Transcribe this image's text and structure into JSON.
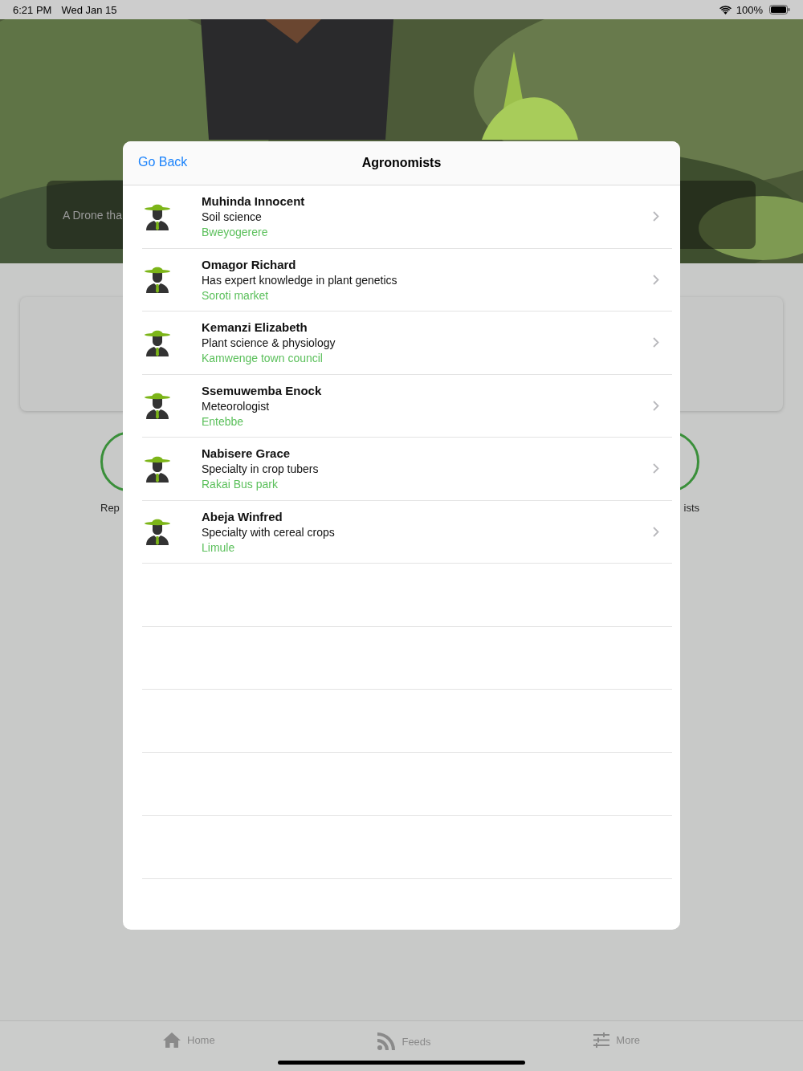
{
  "status_bar": {
    "time": "6:21 PM",
    "date": "Wed Jan 15",
    "battery": "100%"
  },
  "banner": {
    "caption": "A Drone tha"
  },
  "shortcuts": [
    {
      "label": "Rep"
    },
    {
      "label": "ists"
    }
  ],
  "modal": {
    "back": "Go Back",
    "title": "Agronomists",
    "items": [
      {
        "name": "Muhinda Innocent",
        "specialty": "Soil science",
        "location": "Bweyogerere"
      },
      {
        "name": "Omagor Richard",
        "specialty": "Has expert knowledge in plant genetics",
        "location": "Soroti market"
      },
      {
        "name": "Kemanzi Elizabeth",
        "specialty": "Plant science & physiology",
        "location": "Kamwenge town council"
      },
      {
        "name": "Ssemuwemba Enock",
        "specialty": "Meteorologist",
        "location": "Entebbe"
      },
      {
        "name": "Nabisere Grace",
        "specialty": "Specialty in crop tubers",
        "location": "Rakai Bus park"
      },
      {
        "name": "Abeja Winfred",
        "specialty": "Specialty with cereal crops",
        "location": "Limule"
      }
    ]
  },
  "tab_bar": [
    {
      "kind": "home",
      "label": "Home"
    },
    {
      "kind": "feeds",
      "label": "Feeds"
    },
    {
      "kind": "more",
      "label": "More"
    }
  ]
}
